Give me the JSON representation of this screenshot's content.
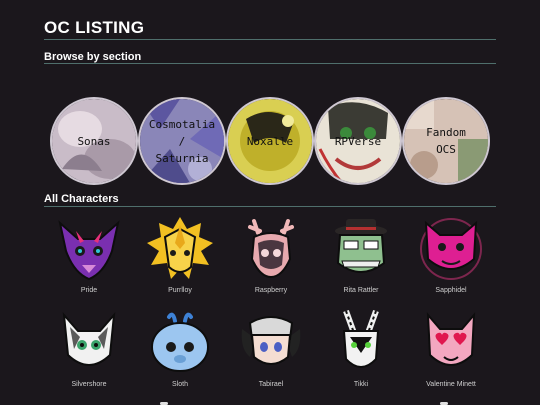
{
  "page": {
    "title": "OC LISTING"
  },
  "sections": {
    "browse": "Browse by section",
    "all": "All Characters"
  },
  "browse_circles": [
    {
      "label": "Sonas"
    },
    {
      "label": "Cosmotalia\n/\nSaturnia"
    },
    {
      "label": "Noxalle"
    },
    {
      "label": "RPVerse"
    },
    {
      "label": "Fandom\nOCS"
    }
  ],
  "characters": [
    {
      "name": "Pride"
    },
    {
      "name": "Purrlloy"
    },
    {
      "name": "Raspberry"
    },
    {
      "name": "Rita Rattler"
    },
    {
      "name": "Sapphidel"
    },
    {
      "name": "Silvershore"
    },
    {
      "name": "Sloth"
    },
    {
      "name": "Tabirael"
    },
    {
      "name": "Tikki"
    },
    {
      "name": "Valentine Minett"
    }
  ],
  "colors": {
    "background": "#1b171c",
    "rule": "#4f6f6c",
    "text": "#ffffff"
  }
}
